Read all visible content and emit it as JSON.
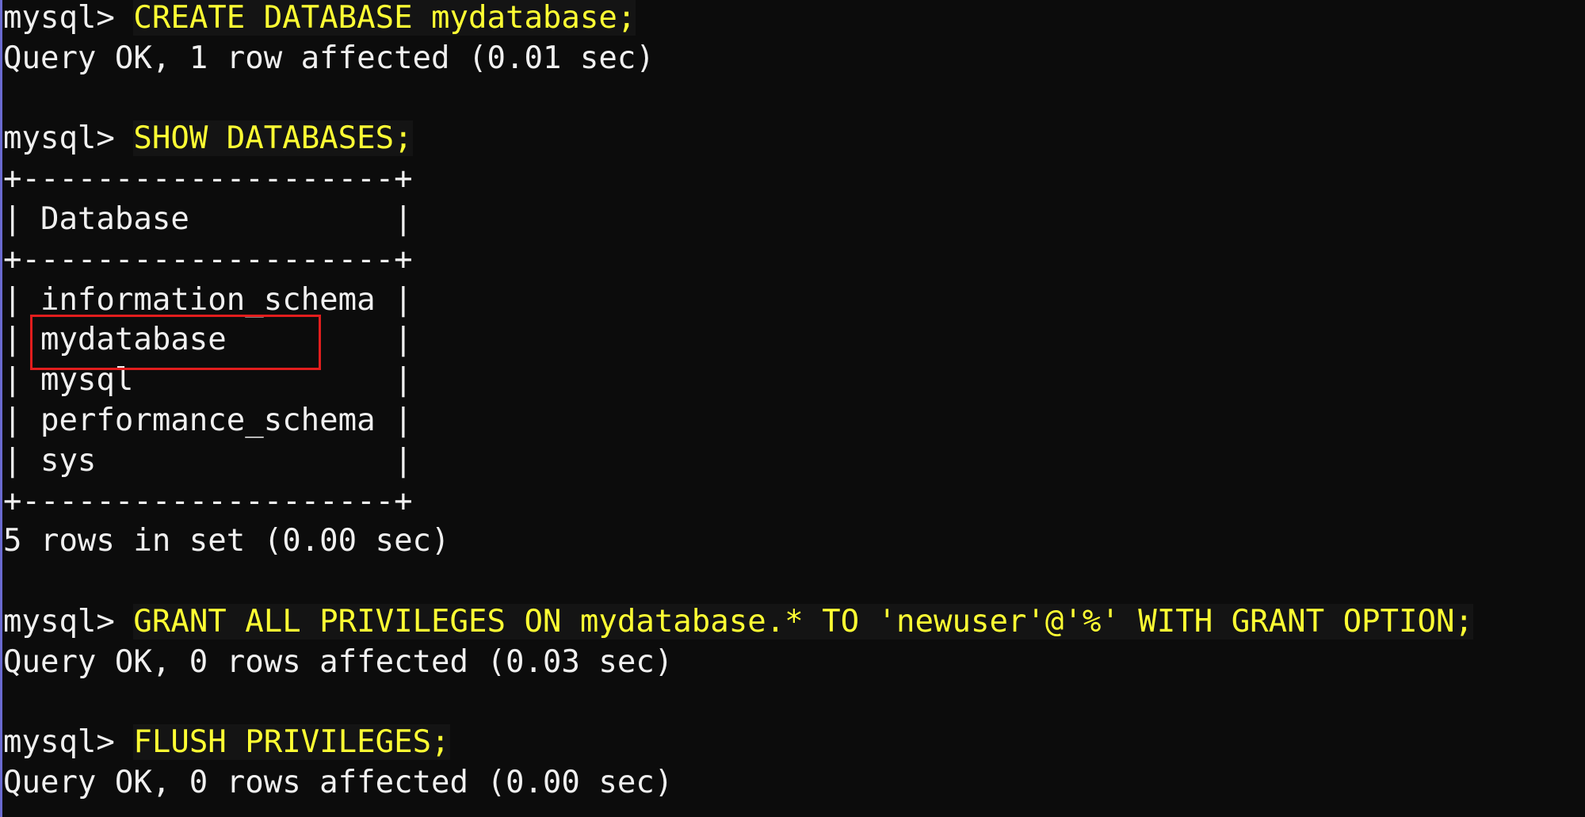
{
  "terminal": {
    "prompt": "mysql> ",
    "lines": [
      {
        "kind": "command",
        "text": "CREATE DATABASE mydatabase;"
      },
      {
        "kind": "output",
        "text": "Query OK, 1 row affected (0.01 sec)"
      },
      {
        "kind": "blank",
        "text": ""
      },
      {
        "kind": "command",
        "text": "SHOW DATABASES;"
      },
      {
        "kind": "output",
        "text": "+--------------------+"
      },
      {
        "kind": "output",
        "text": "| Database           |"
      },
      {
        "kind": "output",
        "text": "+--------------------+"
      },
      {
        "kind": "output",
        "text": "| information_schema |"
      },
      {
        "kind": "output",
        "text": "| mydatabase         |"
      },
      {
        "kind": "output",
        "text": "| mysql              |"
      },
      {
        "kind": "output",
        "text": "| performance_schema |"
      },
      {
        "kind": "output",
        "text": "| sys                |"
      },
      {
        "kind": "output",
        "text": "+--------------------+"
      },
      {
        "kind": "output",
        "text": "5 rows in set (0.00 sec)"
      },
      {
        "kind": "blank",
        "text": ""
      },
      {
        "kind": "command",
        "text": "GRANT ALL PRIVILEGES ON mydatabase.* TO 'newuser'@'%' WITH GRANT OPTION;"
      },
      {
        "kind": "output",
        "text": "Query OK, 0 rows affected (0.03 sec)"
      },
      {
        "kind": "blank",
        "text": ""
      },
      {
        "kind": "command",
        "text": "FLUSH PRIVILEGES;"
      },
      {
        "kind": "output",
        "text": "Query OK, 0 rows affected (0.00 sec)"
      }
    ]
  },
  "colors": {
    "background": "#0c0c0c",
    "command_text": "#ffff33",
    "output_text": "#f0f0f0",
    "highlight_border": "#e21d1d"
  }
}
